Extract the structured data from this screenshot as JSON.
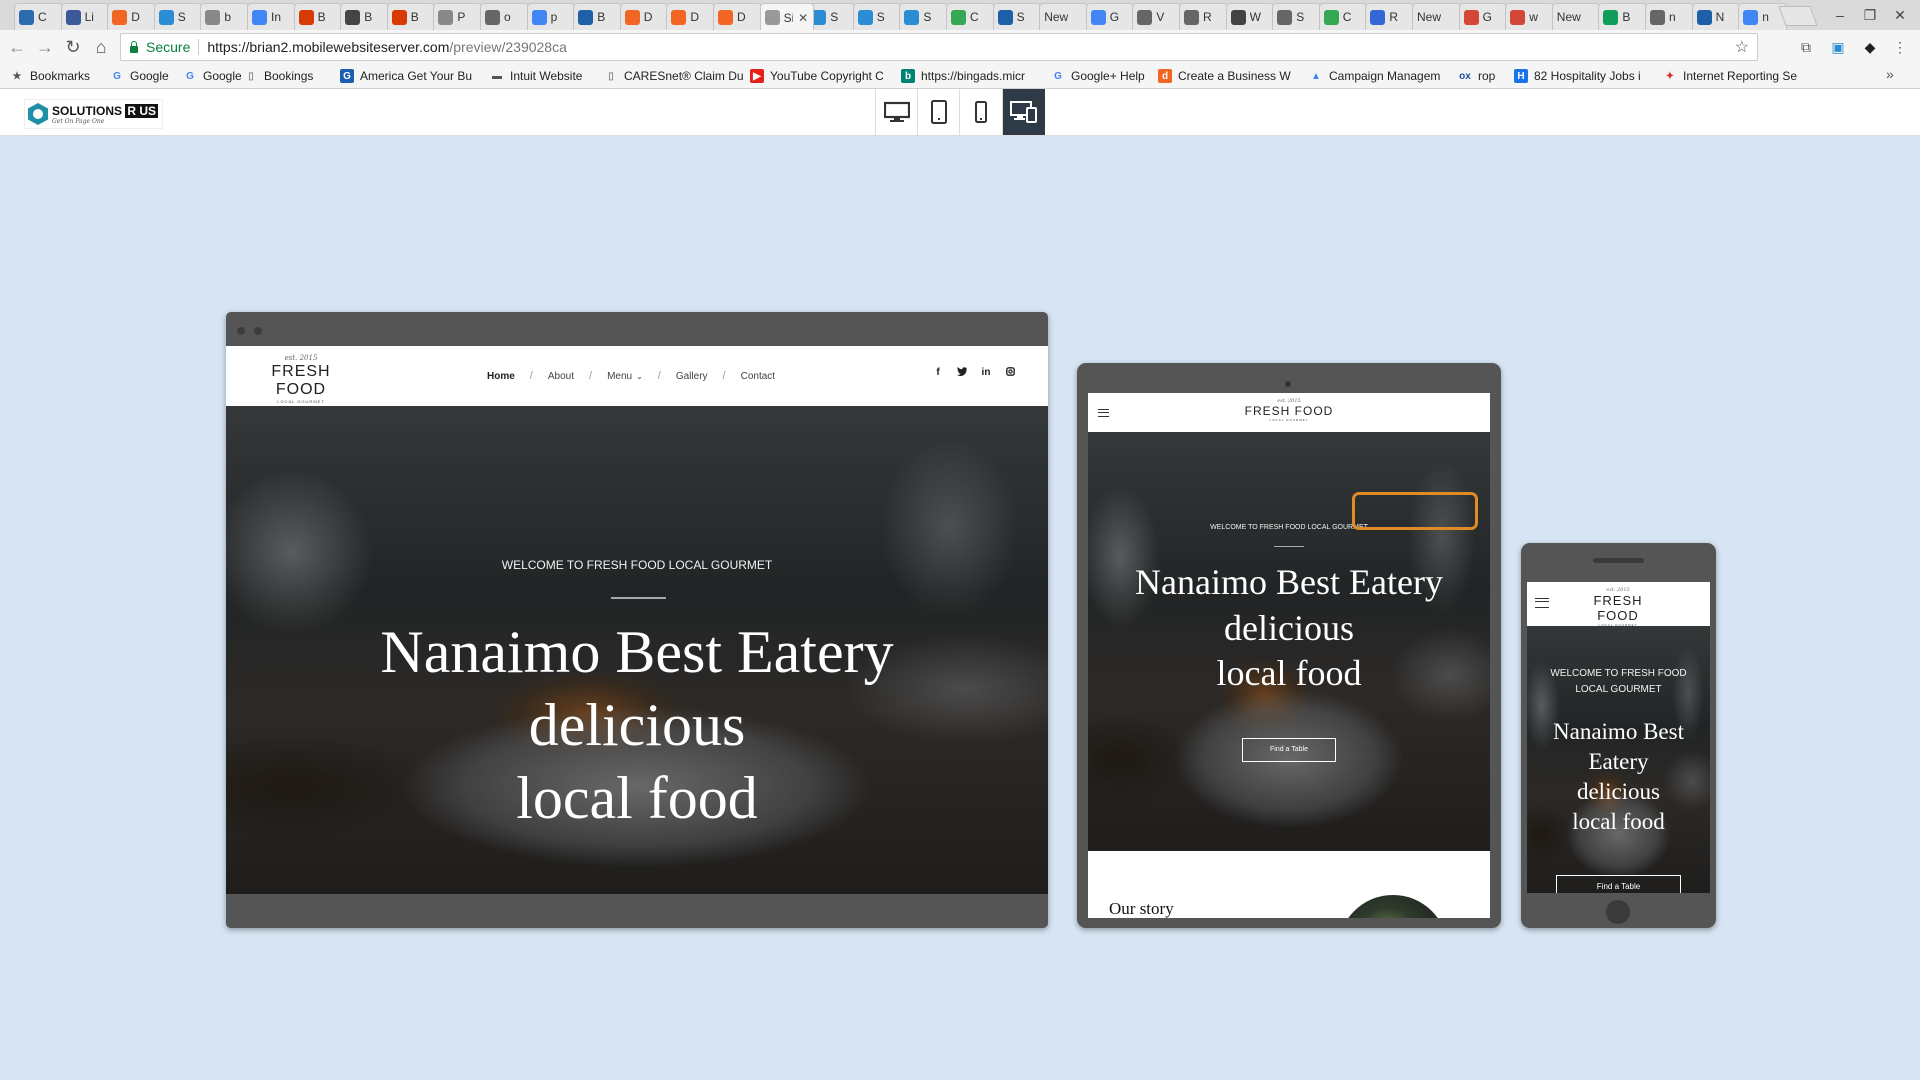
{
  "browser": {
    "tabs": [
      {
        "label": "C",
        "icon": "clock-icon",
        "color": "#2b6cb0"
      },
      {
        "label": "Li",
        "icon": "people-icon",
        "color": "#3b5998"
      },
      {
        "label": "D",
        "icon": "d-icon",
        "color": "#f26522"
      },
      {
        "label": "S",
        "icon": "window-icon",
        "color": "#2a8dd4"
      },
      {
        "label": "b",
        "icon": "page-icon",
        "color": "#888888"
      },
      {
        "label": "In",
        "icon": "google-icon",
        "color": "#4285f4"
      },
      {
        "label": "B",
        "icon": "bing-icon",
        "color": "#d83b01"
      },
      {
        "label": "B",
        "icon": "bing-icon",
        "color": "#444444"
      },
      {
        "label": "B",
        "icon": "bing-icon",
        "color": "#d83b01"
      },
      {
        "label": "P",
        "icon": "page-icon",
        "color": "#888888"
      },
      {
        "label": "o",
        "icon": "folder-icon",
        "color": "#666666"
      },
      {
        "label": "p",
        "icon": "google-icon",
        "color": "#4285f4"
      },
      {
        "label": "B",
        "icon": "grid-icon",
        "color": "#1f5fa8"
      },
      {
        "label": "D",
        "icon": "d-icon",
        "color": "#f26522"
      },
      {
        "label": "D",
        "icon": "d-icon",
        "color": "#f26522"
      },
      {
        "label": "D",
        "icon": "d-icon",
        "color": "#f26522"
      },
      {
        "label": "Si",
        "icon": "page-icon",
        "color": "#999999",
        "active": true
      },
      {
        "label": "S",
        "icon": "window-icon",
        "color": "#2a8dd4"
      },
      {
        "label": "S",
        "icon": "window-icon",
        "color": "#2a8dd4"
      },
      {
        "label": "S",
        "icon": "window-icon",
        "color": "#2a8dd4"
      },
      {
        "label": "C",
        "icon": "ads-icon",
        "color": "#34a853"
      },
      {
        "label": "S",
        "icon": "grid-icon",
        "color": "#1f5fa8"
      },
      {
        "label": "New",
        "icon": "none",
        "color": "#e6e6e6"
      },
      {
        "label": "G",
        "icon": "docs-icon",
        "color": "#4285f4"
      },
      {
        "label": "V",
        "icon": "folder-icon",
        "color": "#666666"
      },
      {
        "label": "R",
        "icon": "folder-icon",
        "color": "#666666"
      },
      {
        "label": "W",
        "icon": "tool-icon",
        "color": "#444444"
      },
      {
        "label": "S",
        "icon": "folder-icon",
        "color": "#666666"
      },
      {
        "label": "C",
        "icon": "ads-icon",
        "color": "#34a853"
      },
      {
        "label": "R",
        "icon": "diamond-icon",
        "color": "#3367d6"
      },
      {
        "label": "New",
        "icon": "none",
        "color": "#e6e6e6"
      },
      {
        "label": "G",
        "icon": "gmail-icon",
        "color": "#d44638"
      },
      {
        "label": "w",
        "icon": "gmail-icon",
        "color": "#d44638"
      },
      {
        "label": "New",
        "icon": "none",
        "color": "#e6e6e6"
      },
      {
        "label": "B",
        "icon": "sheets-icon",
        "color": "#0f9d58"
      },
      {
        "label": "n",
        "icon": "folder-icon",
        "color": "#666666"
      },
      {
        "label": "N",
        "icon": "grid-icon",
        "color": "#1f5fa8"
      },
      {
        "label": "n",
        "icon": "google-icon",
        "color": "#4285f4"
      }
    ],
    "address": {
      "secure_label": "Secure",
      "url_host": "https://brian2.mobilewebsiteserver.com",
      "url_path": "/preview/239028ca"
    },
    "bookmarks": [
      {
        "label": "Bookmarks",
        "icon": "star-icon",
        "color": "#555555"
      },
      {
        "label": "Google",
        "icon": "google-icon",
        "color": "#4285f4"
      },
      {
        "label": "Google",
        "icon": "google-icon",
        "color": "#4285f4"
      },
      {
        "label": "Bookings",
        "icon": "page-icon",
        "color": "#888888"
      },
      {
        "label": "America Get Your Bu",
        "icon": "g-icon",
        "color": "#1a5fb4"
      },
      {
        "label": "Intuit Website",
        "icon": "folder-icon",
        "color": "#555555"
      },
      {
        "label": "CARESnet® Claim Du",
        "icon": "page-icon",
        "color": "#888888"
      },
      {
        "label": "YouTube Copyright C",
        "icon": "youtube-icon",
        "color": "#e62117"
      },
      {
        "label": "https://bingads.micr",
        "icon": "bing-icon",
        "color": "#008373"
      },
      {
        "label": "Google+ Help",
        "icon": "google-icon",
        "color": "#4285f4"
      },
      {
        "label": "Create a Business W",
        "icon": "d-icon",
        "color": "#f26522"
      },
      {
        "label": "Campaign Managem",
        "icon": "ads-icon",
        "color": "#4285f4"
      },
      {
        "label": "rop",
        "icon": "ox-icon",
        "color": "#1f4e9e"
      },
      {
        "label": "82 Hospitality Jobs i",
        "icon": "h-icon",
        "color": "#1a73e8"
      },
      {
        "label": "Internet Reporting Se",
        "icon": "maple-leaf-icon",
        "color": "#d52b1e"
      }
    ]
  },
  "preview": {
    "logo_main": "SOLUTIONS",
    "logo_accent": "R US",
    "logo_tagline": "Get On Page One"
  },
  "site": {
    "brand_est": "est. 2015",
    "brand_name": "FRESH FOOD",
    "brand_sub": "LOCAL GOURMET",
    "nav": [
      "Home",
      "About",
      "Menu",
      "Gallery",
      "Contact"
    ],
    "social": [
      "f",
      "t",
      "in",
      "ig"
    ],
    "welcome": "WELCOME TO FRESH FOOD LOCAL GOURMET",
    "headline_1": "Nanaimo Best Eatery",
    "headline_2": "delicious",
    "headline_3": "local food",
    "cta_tablet": "Find a Table",
    "cta_phone": "Find a Table",
    "story_title": "Our story"
  }
}
